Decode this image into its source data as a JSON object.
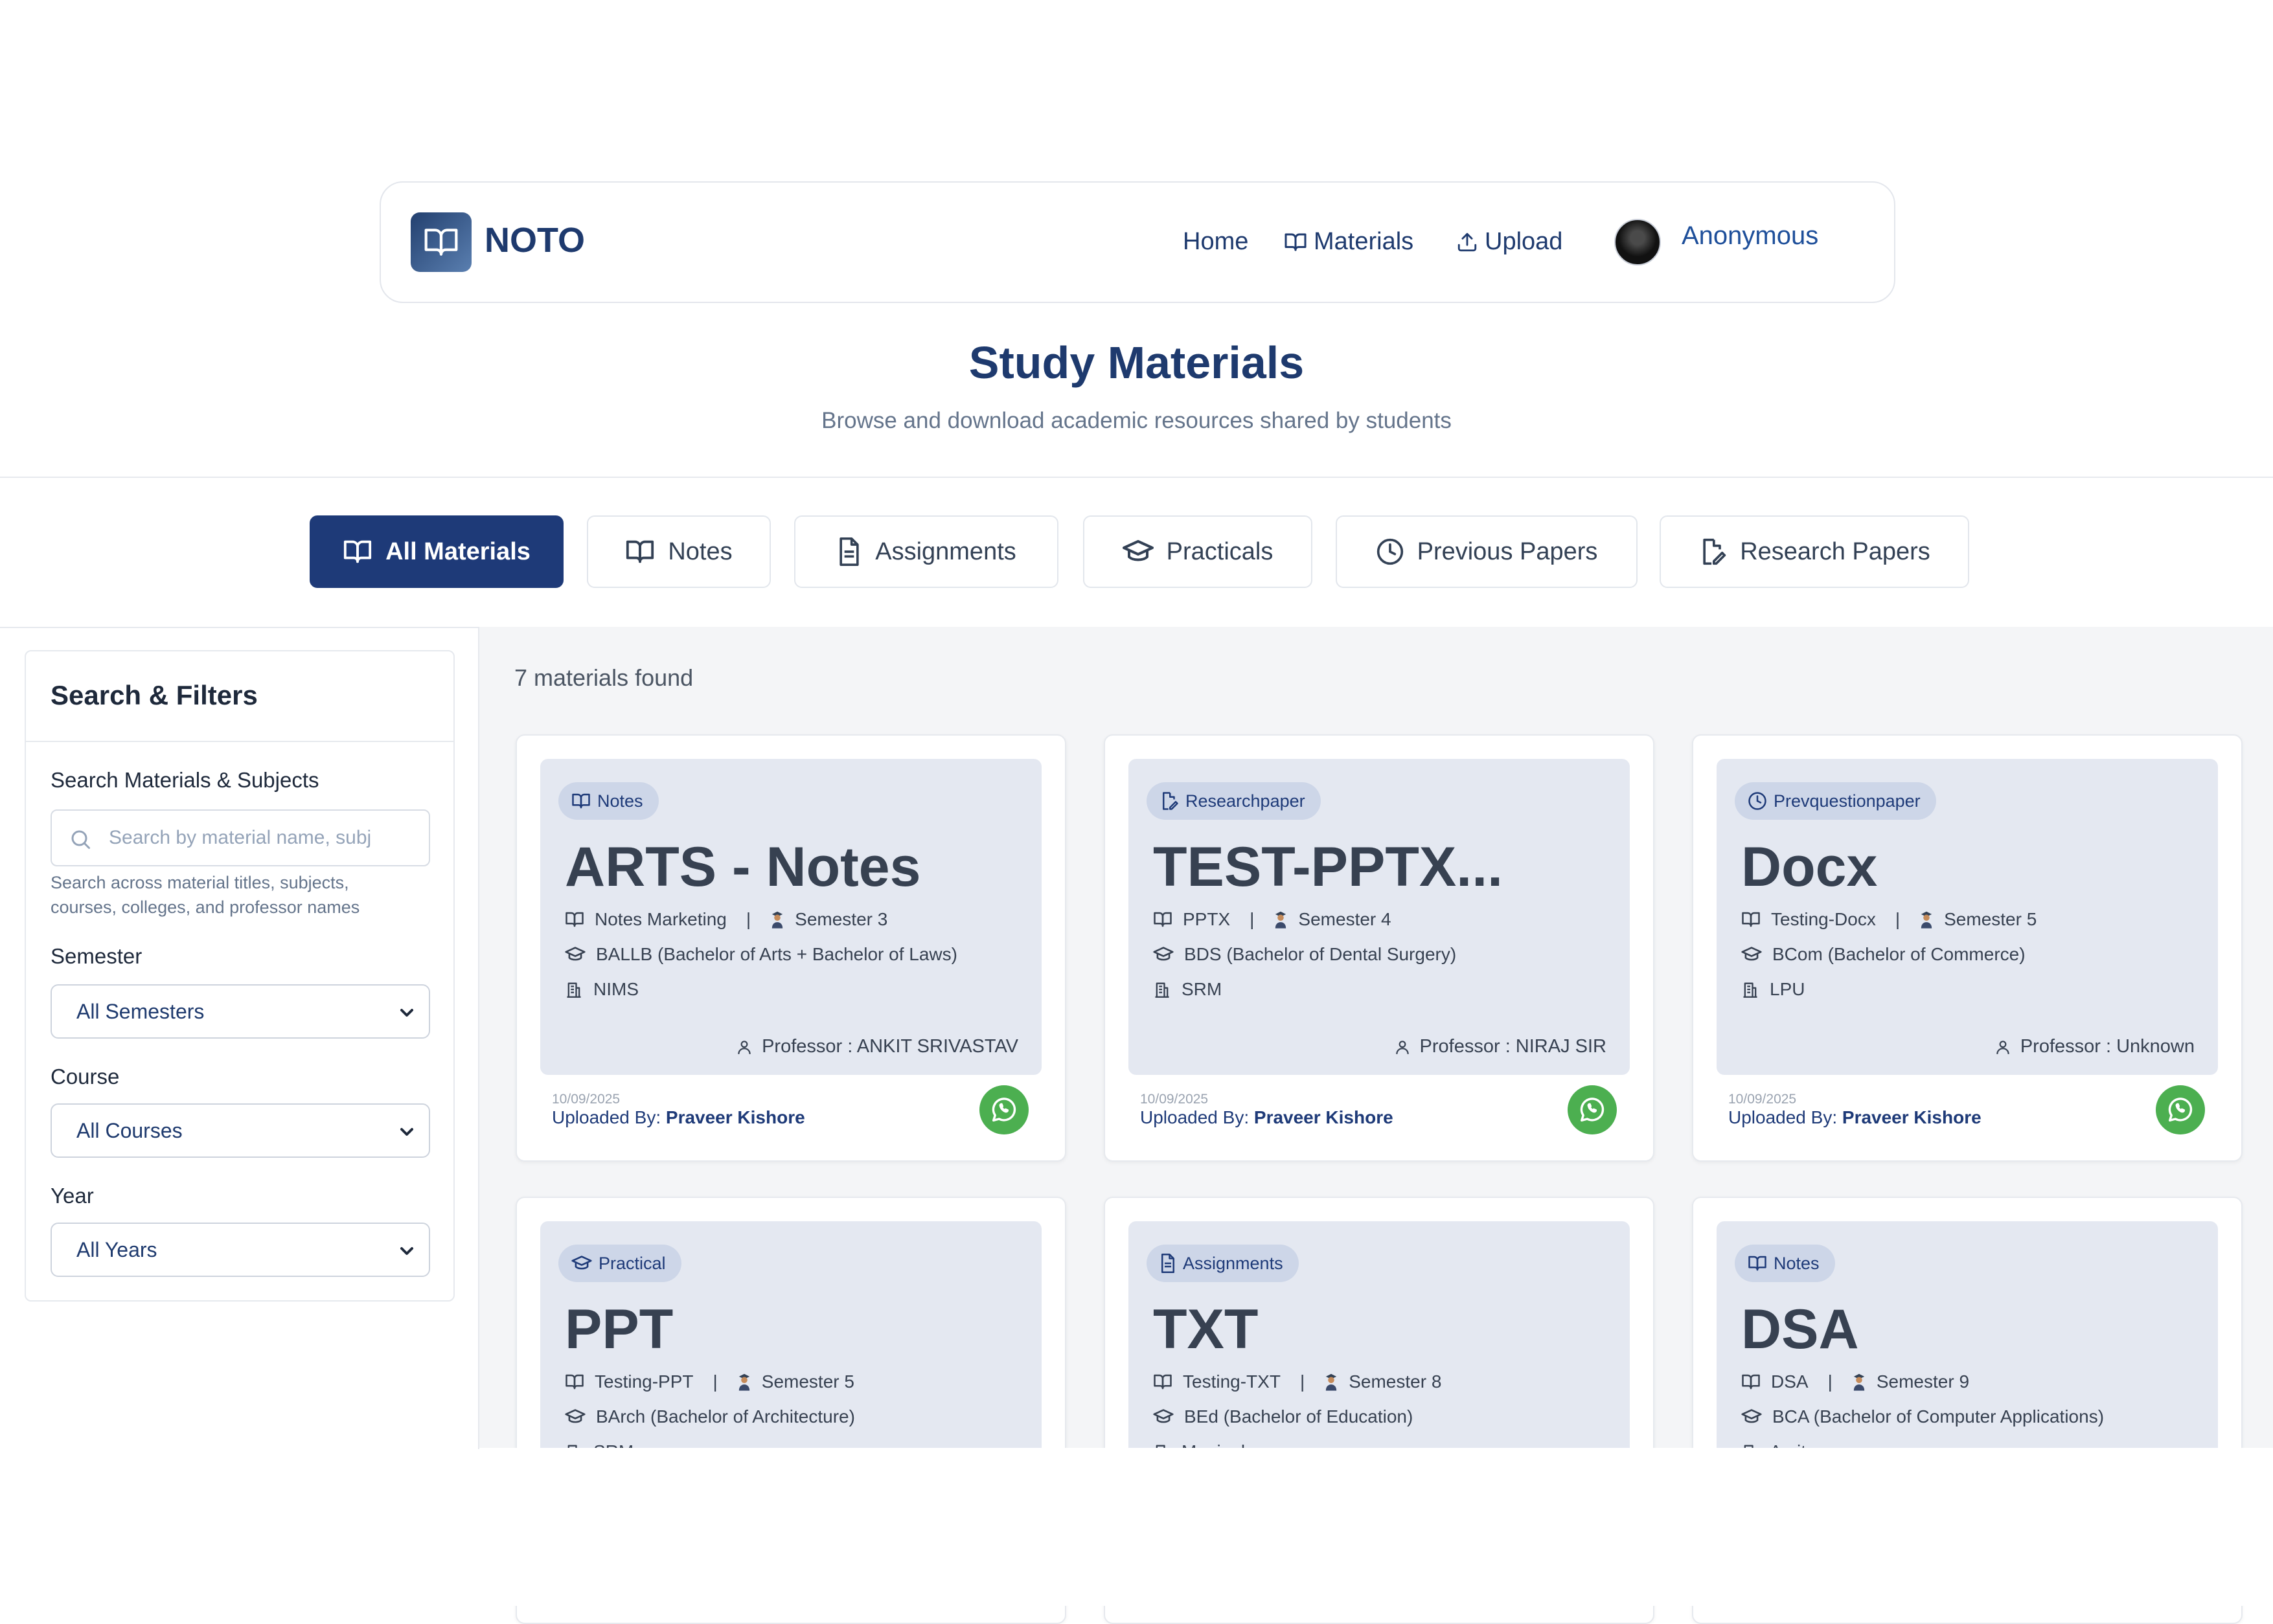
{
  "nav": {
    "brand": "NOTO",
    "links": {
      "home": "Home",
      "materials": "Materials",
      "upload": "Upload"
    },
    "user_name": "Anonymous"
  },
  "header": {
    "title": "Study Materials",
    "subtitle": "Browse and download academic resources shared by students"
  },
  "tabs": [
    {
      "label": "All Materials",
      "icon": "book-icon",
      "active": true
    },
    {
      "label": "Notes",
      "icon": "book-icon",
      "active": false
    },
    {
      "label": "Assignments",
      "icon": "file-text-icon",
      "active": false
    },
    {
      "label": "Practicals",
      "icon": "graduation-cap-icon",
      "active": false
    },
    {
      "label": "Previous Papers",
      "icon": "clock-icon",
      "active": false
    },
    {
      "label": "Research Papers",
      "icon": "file-edit-icon",
      "active": false
    }
  ],
  "filters": {
    "title": "Search & Filters",
    "search_label": "Search Materials & Subjects",
    "search_placeholder": "Search by material name, subj",
    "search_help": "Search across material titles, subjects, courses, colleges, and professor names",
    "semester_label": "Semester",
    "semester_value": "All Semesters",
    "course_label": "Course",
    "course_value": "All Courses",
    "year_label": "Year",
    "year_value": "All Years"
  },
  "results": {
    "count_text": "7 materials found"
  },
  "cards": [
    {
      "badge": "Notes",
      "badge_icon": "book-icon",
      "title": "ARTS - Notes",
      "subject": "Notes Marketing",
      "semester": "Semester 3",
      "course": "BALLB (Bachelor of Arts + Bachelor of Laws)",
      "college": "NIMS",
      "professor": "Professor : ANKIT SRIVASTAV",
      "date": "10/09/2025",
      "uploaded_by_label": "Uploaded By:",
      "uploader": "Praveer Kishore"
    },
    {
      "badge": "Researchpaper",
      "badge_icon": "file-edit-icon",
      "title": "TEST-PPTX...",
      "subject": "PPTX",
      "semester": "Semester 4",
      "course": "BDS (Bachelor of Dental Surgery)",
      "college": "SRM",
      "professor": "Professor : NIRAJ SIR",
      "date": "10/09/2025",
      "uploaded_by_label": "Uploaded By:",
      "uploader": "Praveer Kishore"
    },
    {
      "badge": "Prevquestionpaper",
      "badge_icon": "clock-icon",
      "title": "Docx",
      "subject": "Testing-Docx",
      "semester": "Semester 5",
      "course": "BCom (Bachelor of Commerce)",
      "college": "LPU",
      "professor": "Professor : Unknown",
      "date": "10/09/2025",
      "uploaded_by_label": "Uploaded By:",
      "uploader": "Praveer Kishore"
    },
    {
      "badge": "Practical",
      "badge_icon": "graduation-cap-icon",
      "title": "PPT",
      "subject": "Testing-PPT",
      "semester": "Semester 5",
      "course": "BArch (Bachelor of Architecture)",
      "college": "SRM",
      "professor": "",
      "date": "",
      "uploaded_by_label": "",
      "uploader": ""
    },
    {
      "badge": "Assignments",
      "badge_icon": "file-text-icon",
      "title": "TXT",
      "subject": "Testing-TXT",
      "semester": "Semester 8",
      "course": "BEd (Bachelor of Education)",
      "college": "Manipal",
      "professor": "",
      "date": "",
      "uploaded_by_label": "",
      "uploader": ""
    },
    {
      "badge": "Notes",
      "badge_icon": "book-icon",
      "title": "DSA",
      "subject": "DSA",
      "semester": "Semester 9",
      "course": "BCA (Bachelor of Computer Applications)",
      "college": "Amity",
      "professor": "",
      "date": "",
      "uploaded_by_label": "",
      "uploader": ""
    }
  ],
  "colors": {
    "primary": "#1e3a78",
    "card_inner": "#e4e8f1",
    "whatsapp": "#4caf50",
    "page_bg": "#f4f5f7"
  }
}
